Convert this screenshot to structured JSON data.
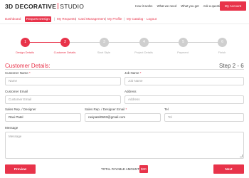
{
  "header": {
    "brand_main": "3D DECORATIVE",
    "brand_sub": "STUDIO",
    "nav": [
      "How it works",
      "What we need",
      "What you get",
      "Ask a question"
    ],
    "account_button": "My Account"
  },
  "subnav": {
    "items": [
      {
        "label": "Dashboard",
        "active": false
      },
      {
        "label": "Request Design",
        "active": true
      },
      {
        "label": "My Requests",
        "active": false
      },
      {
        "label": "Card Management",
        "active": false
      },
      {
        "label": "My Profile",
        "active": false
      },
      {
        "label": "My Catalog",
        "active": false
      },
      {
        "label": "Logout",
        "active": false
      }
    ],
    "separators": [
      "|",
      "|",
      "|",
      "|",
      "-"
    ]
  },
  "stepper": {
    "current_step": 2,
    "total_steps": 6,
    "steps": [
      {
        "number": "1",
        "label": "Design Details",
        "state": "done"
      },
      {
        "number": "2",
        "label": "Customer Details",
        "state": "current"
      },
      {
        "number": "3",
        "label": "Start Style",
        "state": "pending"
      },
      {
        "number": "4",
        "label": "Project Details",
        "state": "pending"
      },
      {
        "number": "5",
        "label": "Payment",
        "state": "pending"
      },
      {
        "number": "6",
        "label": "Finish",
        "state": "pending"
      }
    ]
  },
  "form": {
    "title": "Customer Details:",
    "step_indicator": "Step 2 - 6",
    "fields": {
      "customer_name": {
        "label": "Customer Name",
        "required": "*",
        "placeholder": "Name",
        "value": ""
      },
      "job_name": {
        "label": "Job Name",
        "required": "*",
        "placeholder": "Job Name",
        "value": ""
      },
      "customer_email": {
        "label": "Customer Email",
        "placeholder": "Customer Email",
        "value": ""
      },
      "address": {
        "label": "Address",
        "placeholder": "Address",
        "value": ""
      },
      "sales_rep": {
        "label": "Sales Rep. / Designer",
        "value": "Ravi Patel"
      },
      "sales_rep_email": {
        "label": "Sales Rep. / Designer Email",
        "required": "*",
        "value": "ravipatel0603@gmail.com"
      },
      "tel": {
        "label": "Tel",
        "placeholder": "Tel",
        "value": ""
      },
      "message": {
        "label": "Message",
        "placeholder": "Message",
        "value": ""
      }
    }
  },
  "footer": {
    "preview_button": "Preview",
    "total_label": "TOTAL PAYABLE AMOUNT",
    "total_amount": "$30",
    "next_button": "Next"
  },
  "colors": {
    "accent": "#e8334a",
    "pending": "#cfcfcf"
  }
}
